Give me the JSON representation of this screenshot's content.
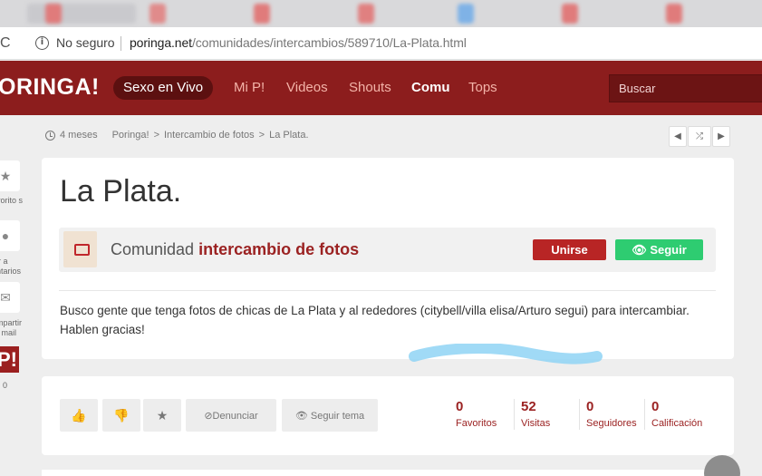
{
  "browser": {
    "not_secure_label": "No seguro",
    "url_domain": "poringa.net",
    "url_path": "/comunidades/intercambios/589710/La-Plata.html"
  },
  "header": {
    "logo": "ORINGA!",
    "nav": {
      "live": "Sexo en Vivo",
      "mip": "Mi P!",
      "videos": "Videos",
      "shouts": "Shouts",
      "comu": "Comu",
      "tops": "Tops"
    },
    "search_placeholder": "Buscar"
  },
  "rail": {
    "favorites": "vorito s",
    "comments_1": "ir a",
    "comments_2": "ntarios",
    "share_1": "mpartir",
    "share_2": "r mail",
    "logo": "P!",
    "count": "0"
  },
  "breadcrumb": {
    "time": "4 meses",
    "site": "Poringa!",
    "section": "Intercambio de fotos",
    "current": "La Plata."
  },
  "post": {
    "title": "La Plata.",
    "community_prefix": "Comunidad",
    "community_name": "intercambio de fotos",
    "join_label": "Unirse",
    "follow_label": "Seguir",
    "body": "Busco gente que tenga fotos de chicas de La Plata y al rededores (citybell/villa elisa/Arturo segui) para intercambiar. Hablen gracias!"
  },
  "actions": {
    "report_label": "Denunciar",
    "follow_topic_label": "Seguir tema"
  },
  "stats": [
    {
      "value": "0",
      "label": "Favoritos"
    },
    {
      "value": "52",
      "label": "Visitas"
    },
    {
      "value": "0",
      "label": "Seguidores"
    },
    {
      "value": "0",
      "label": "Calificación"
    }
  ],
  "colors": {
    "brand_red": "#8c1d1d",
    "join_button": "#b82525",
    "follow_button": "#2ecc71"
  }
}
